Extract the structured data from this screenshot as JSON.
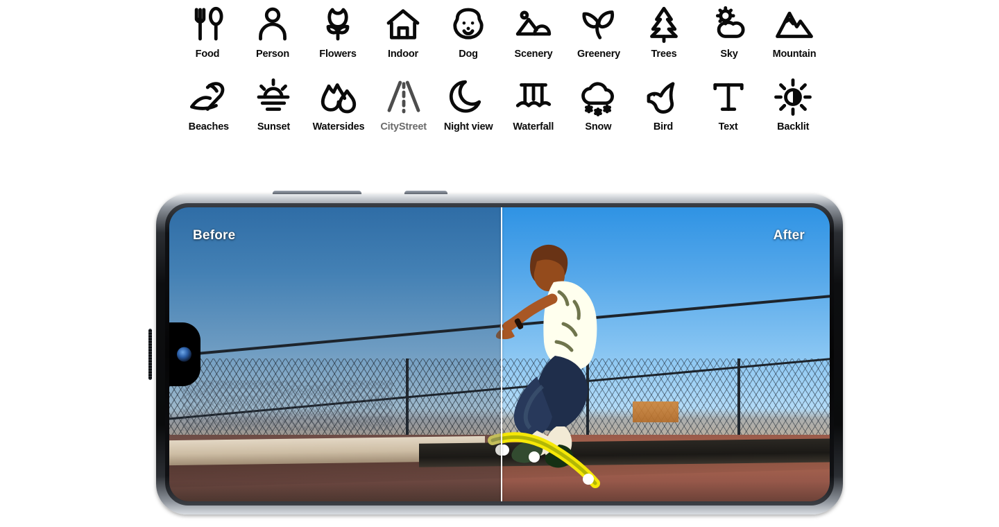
{
  "scene_optimizer": {
    "rows": [
      [
        {
          "id": "food",
          "label": "Food",
          "icon": "fork-spoon-icon",
          "dim": false
        },
        {
          "id": "person",
          "label": "Person",
          "icon": "person-icon",
          "dim": false
        },
        {
          "id": "flowers",
          "label": "Flowers",
          "icon": "tulip-icon",
          "dim": false
        },
        {
          "id": "indoor",
          "label": "Indoor",
          "icon": "house-icon",
          "dim": false
        },
        {
          "id": "dog",
          "label": "Dog",
          "icon": "dog-face-icon",
          "dim": false
        },
        {
          "id": "scenery",
          "label": "Scenery",
          "icon": "landscape-photo-icon",
          "dim": false
        },
        {
          "id": "greenery",
          "label": "Greenery",
          "icon": "leaf-sprout-icon",
          "dim": false
        },
        {
          "id": "trees",
          "label": "Trees",
          "icon": "pine-tree-icon",
          "dim": false
        },
        {
          "id": "sky",
          "label": "Sky",
          "icon": "sun-cloud-icon",
          "dim": false
        },
        {
          "id": "mountain",
          "label": "Mountain",
          "icon": "mountain-peaks-icon",
          "dim": false
        }
      ],
      [
        {
          "id": "beaches",
          "label": "Beaches",
          "icon": "beach-umbrella-icon",
          "dim": false
        },
        {
          "id": "sunset",
          "label": "Sunset",
          "icon": "sunset-icon",
          "dim": false
        },
        {
          "id": "watersides",
          "label": "Watersides",
          "icon": "water-drop-rock-icon",
          "dim": false
        },
        {
          "id": "citystreet",
          "label": "CityStreet",
          "icon": "road-icon",
          "dim": true
        },
        {
          "id": "nightview",
          "label": "Night view",
          "icon": "crescent-moon-icon",
          "dim": false
        },
        {
          "id": "waterfall",
          "label": "Waterfall",
          "icon": "waterfall-icon",
          "dim": false
        },
        {
          "id": "snow",
          "label": "Snow",
          "icon": "snow-cloud-icon",
          "dim": false
        },
        {
          "id": "bird",
          "label": "Bird",
          "icon": "bird-icon",
          "dim": false
        },
        {
          "id": "text",
          "label": "Text",
          "icon": "text-t-icon",
          "dim": false
        },
        {
          "id": "backlit",
          "label": "Backlit",
          "icon": "backlit-sun-icon",
          "dim": false
        }
      ]
    ]
  },
  "device": {
    "orientation": "landscape",
    "camera": "punch-hole-camera",
    "buttons": [
      "volume-rocker",
      "power-button"
    ]
  },
  "comparison": {
    "before_label": "Before",
    "after_label": "After",
    "divider": "vertical-split-handle",
    "subject": "skateboarder mid-trick on outdoor court",
    "colors": {
      "before_sky_top": "#2f6da6",
      "before_sky_bottom": "#b9c8d2",
      "after_sky_top": "#2f93e4",
      "after_sky_bottom": "#cfe8fa",
      "before_ground": "#7d5348",
      "after_ground": "#ad674f",
      "divider_line": "#ffffff",
      "label_text": "#ffffff"
    }
  },
  "theme": {
    "page_background": "#ffffff",
    "icon_color": "#0a0a0a",
    "icon_color_dim": "#4d4d4d",
    "label_color": "#0a0a0a",
    "label_color_dim": "#6b6b6b"
  }
}
